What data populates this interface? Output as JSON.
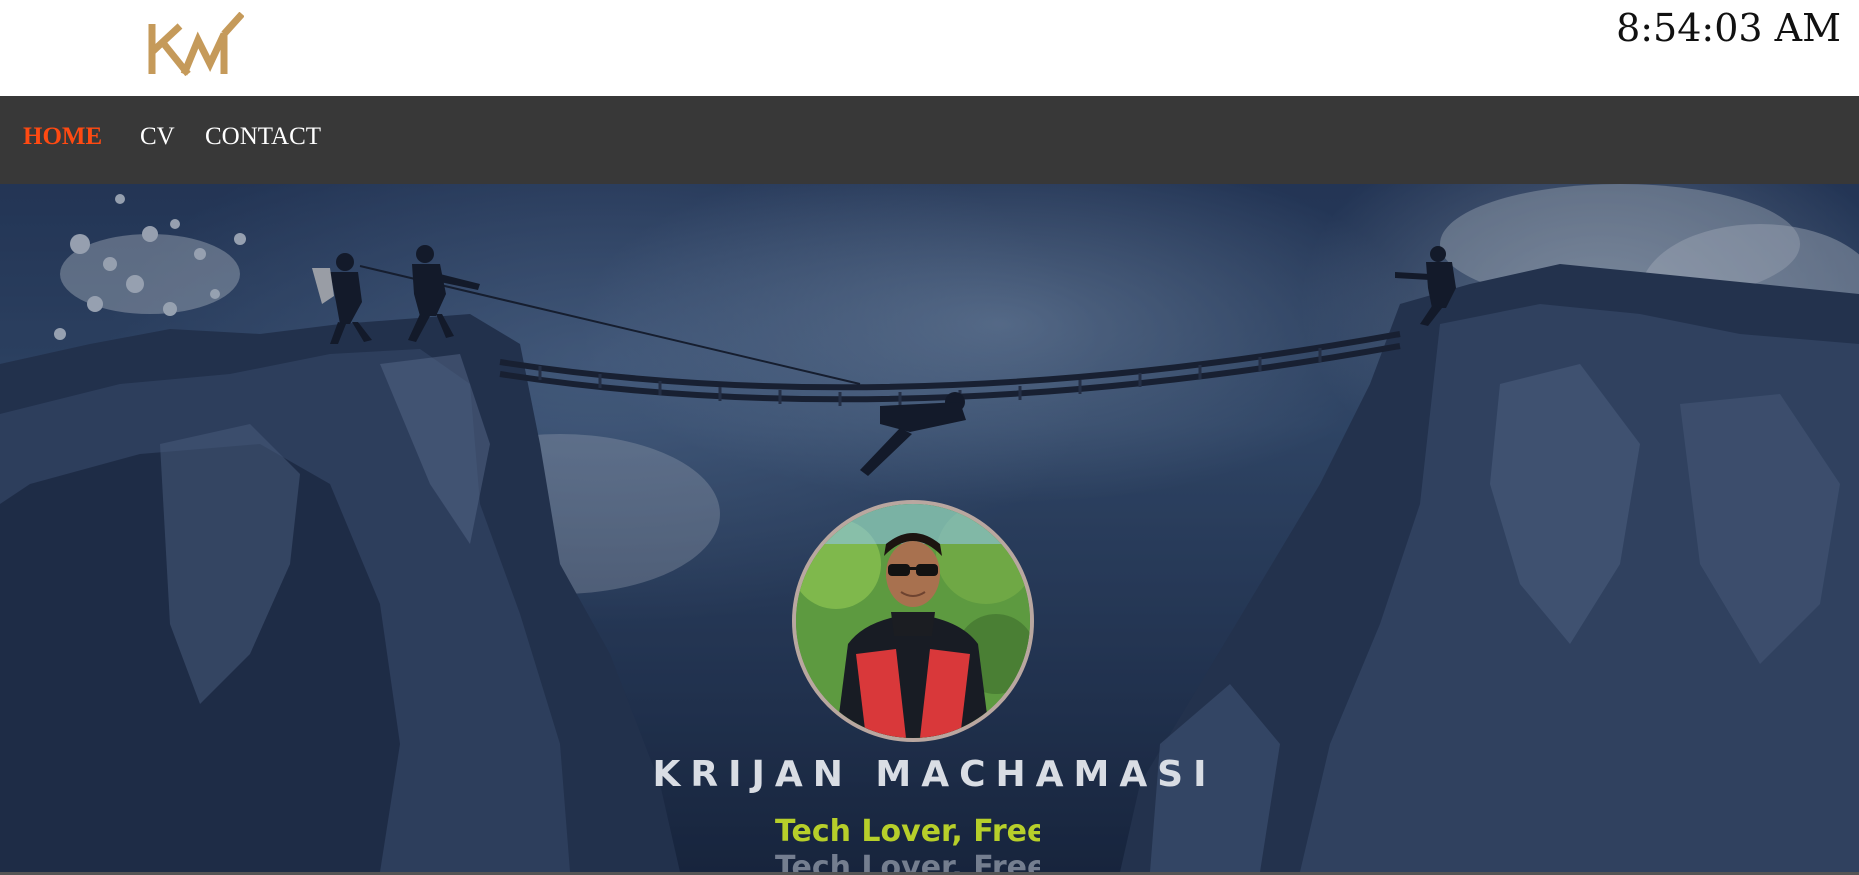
{
  "header": {
    "logo_icon": "km-monogram-logo",
    "logo_color": "#c59a5a",
    "clock_text": "8:54:03 AM"
  },
  "nav": {
    "items": [
      {
        "label": "HOME",
        "active": true
      },
      {
        "label": "CV",
        "active": false
      },
      {
        "label": "CONTACT",
        "active": false
      }
    ],
    "active_color": "#ff4a12",
    "background": "#383838"
  },
  "hero": {
    "name": "KRIJAN MACHAMASI",
    "tagline": "Tech Lover, Free",
    "tagline_color": "#b7cf2a"
  }
}
